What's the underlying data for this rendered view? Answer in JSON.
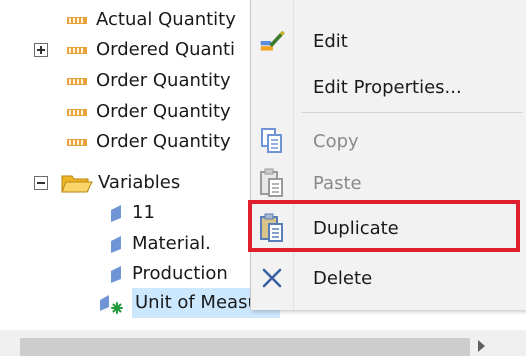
{
  "tree": {
    "items": [
      {
        "label": "Actual Quantity",
        "icon": "measure-icon"
      },
      {
        "label": "Ordered Quanti",
        "icon": "measure-icon",
        "expander": "plus"
      },
      {
        "label": "Order Quantity",
        "icon": "measure-icon"
      },
      {
        "label": "Order Quantity",
        "icon": "measure-icon"
      },
      {
        "label": "Order Quantity",
        "icon": "measure-icon"
      },
      {
        "label": "Variables",
        "icon": "folder-open-icon",
        "expander": "minus"
      },
      {
        "label": "11",
        "icon": "variable-icon"
      },
      {
        "label": "Material.",
        "icon": "variable-icon"
      },
      {
        "label": "Production",
        "icon": "variable-icon"
      },
      {
        "label": "Unit of Measure",
        "icon": "variable-new-icon",
        "selected": true
      }
    ]
  },
  "context_menu": {
    "items": [
      {
        "label": "Edit",
        "icon": "edit-icon",
        "enabled": true
      },
      {
        "label": "Edit Properties...",
        "icon": "",
        "enabled": true
      },
      {
        "label": "Copy",
        "icon": "copy-icon",
        "enabled": false
      },
      {
        "label": "Paste",
        "icon": "paste-icon",
        "enabled": false
      },
      {
        "label": "Duplicate",
        "icon": "duplicate-icon",
        "enabled": true,
        "highlighted": true
      },
      {
        "label": "Delete",
        "icon": "delete-icon",
        "enabled": true
      }
    ]
  },
  "colors": {
    "highlight_border": "#e0202e",
    "selection_bg": "#cce8ff",
    "measure_icon": "#e8a33d",
    "folder_icon": "#f5c342",
    "delete_icon": "#3a5fa0"
  }
}
